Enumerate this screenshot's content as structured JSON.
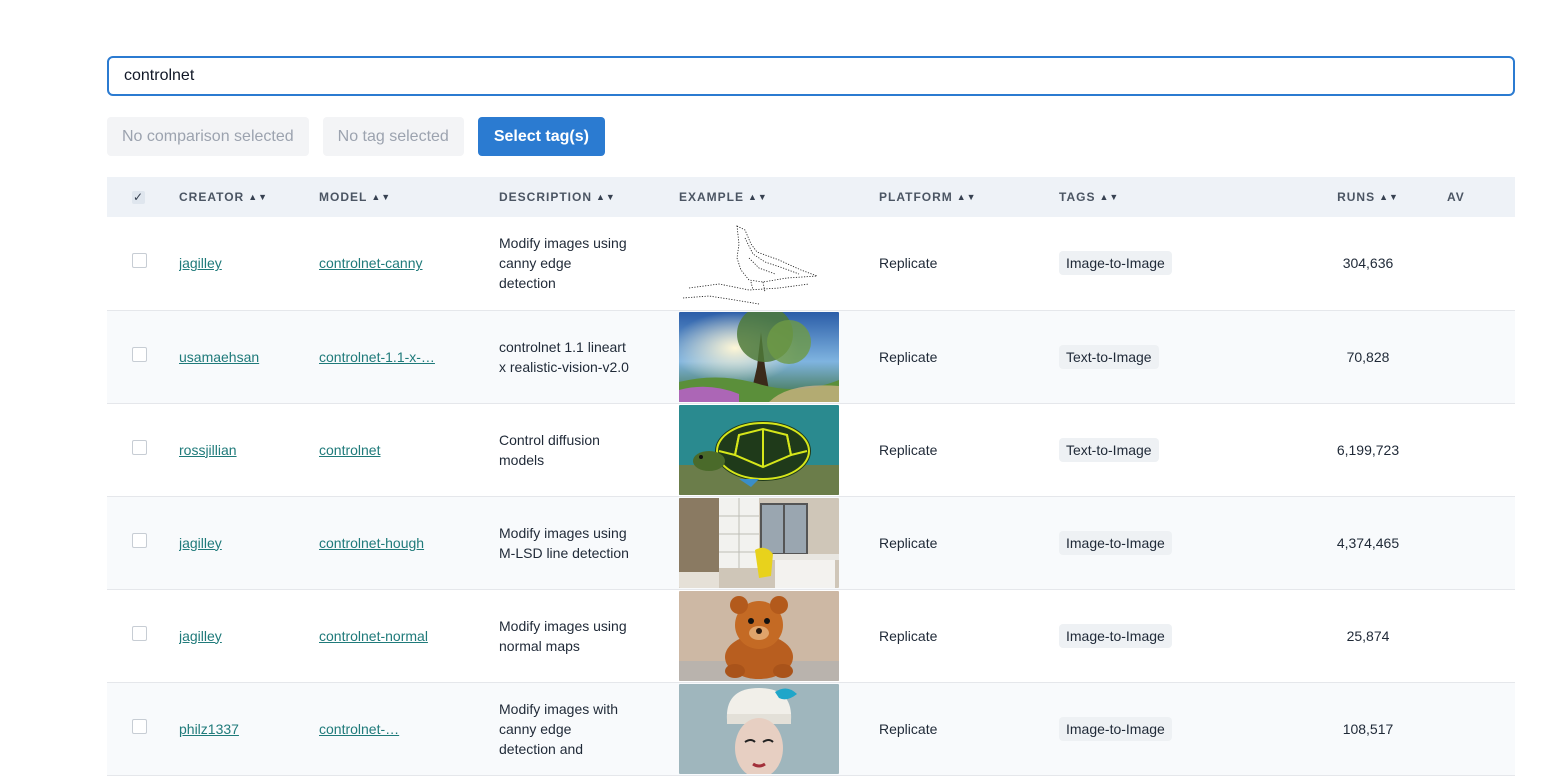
{
  "search": {
    "value": "controlnet"
  },
  "filters": {
    "comparison": "No comparison selected",
    "tag": "No tag selected",
    "select_tags": "Select tag(s)"
  },
  "table": {
    "headers": {
      "creator": "CREATOR",
      "model": "MODEL",
      "description": "DESCRIPTION",
      "example": "EXAMPLE",
      "platform": "PLATFORM",
      "tags": "TAGS",
      "runs": "RUNS",
      "avg": "AV"
    },
    "rows": [
      {
        "creator": "jagilley",
        "model": "controlnet-canny",
        "description": "Modify images using canny edge detection",
        "platform": "Replicate",
        "tag": "Image-to-Image",
        "runs": "304,636",
        "image": "sketch"
      },
      {
        "creator": "usamaehsan",
        "model": "controlnet-1.1-x-…",
        "description": "controlnet 1.1 lineart x realistic-vision-v2.0",
        "platform": "Replicate",
        "tag": "Text-to-Image",
        "runs": "70,828",
        "image": "forest"
      },
      {
        "creator": "rossjillian",
        "model": "controlnet",
        "description": "Control diffusion models",
        "platform": "Replicate",
        "tag": "Text-to-Image",
        "runs": "6,199,723",
        "image": "turtle"
      },
      {
        "creator": "jagilley",
        "model": "controlnet-hough",
        "description": "Modify images using M-LSD line detection",
        "platform": "Replicate",
        "tag": "Image-to-Image",
        "runs": "4,374,465",
        "image": "room"
      },
      {
        "creator": "jagilley",
        "model": "controlnet-normal",
        "description": "Modify images using normal maps",
        "platform": "Replicate",
        "tag": "Image-to-Image",
        "runs": "25,874",
        "image": "bear"
      },
      {
        "creator": "philz1337",
        "model": "controlnet-…",
        "description": "Modify images with canny edge detection and",
        "platform": "Replicate",
        "tag": "Image-to-Image",
        "runs": "108,517",
        "image": "chef"
      }
    ]
  },
  "colors": {
    "accent": "#2b7bd1",
    "link": "#1f7a7a",
    "header_bg": "#eef2f7"
  }
}
